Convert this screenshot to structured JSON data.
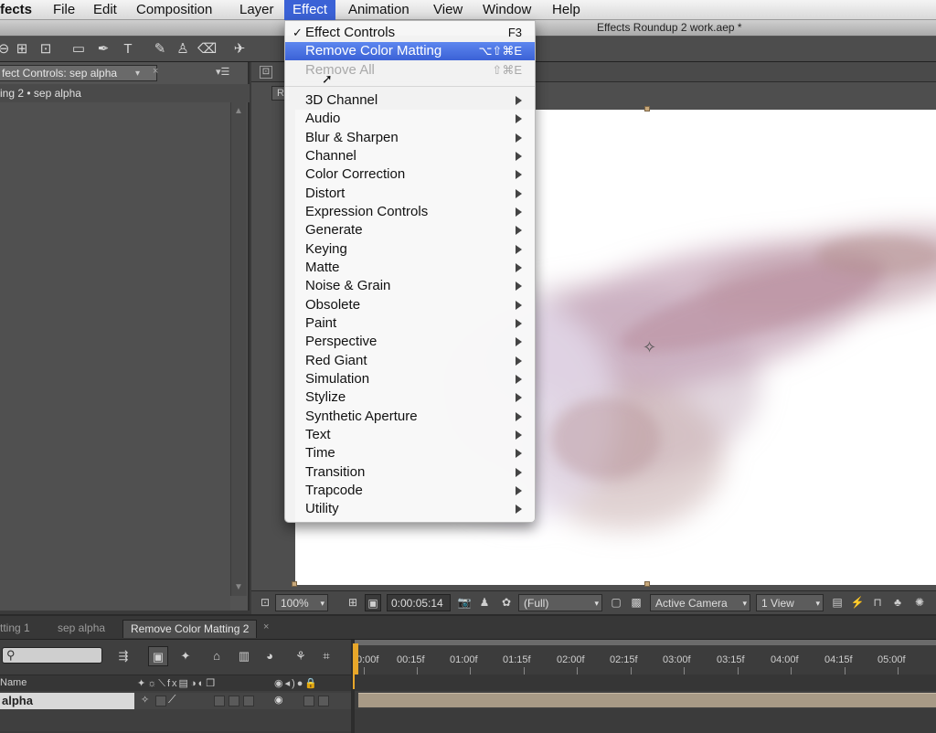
{
  "menubar": {
    "app": "fects",
    "items": [
      "File",
      "Edit",
      "Composition",
      "Layer",
      "Effect",
      "Animation",
      "View",
      "Window",
      "Help"
    ],
    "active": "Effect"
  },
  "window": {
    "title": "Effects Roundup 2 work.aep *"
  },
  "effect_menu": {
    "top_items": [
      {
        "label": "Effect Controls",
        "shortcut": "F3",
        "checked": true
      },
      {
        "label": "Remove Color Matting",
        "shortcut": "⌥⇧⌘E",
        "highlighted": true
      },
      {
        "label": "Remove All",
        "shortcut": "⇧⌘E",
        "disabled": true
      }
    ],
    "categories": [
      "3D Channel",
      "Audio",
      "Blur & Sharpen",
      "Channel",
      "Color Correction",
      "Distort",
      "Expression Controls",
      "Generate",
      "Keying",
      "Matte",
      "Noise & Grain",
      "Obsolete",
      "Paint",
      "Perspective",
      "Red Giant",
      "Simulation",
      "Stylize",
      "Synthetic Aperture",
      "Text",
      "Time",
      "Transition",
      "Trapcode",
      "Utility"
    ]
  },
  "left_panel": {
    "tab_label": "fect Controls: sep alpha",
    "subtitle": "ing 2 • sep alpha"
  },
  "comp_panel": {
    "r_button": "R"
  },
  "viewer_bar": {
    "zoom": "100%",
    "timecode": "0:00:05:14",
    "resolution": "(Full)",
    "camera": "Active Camera",
    "views": "1 View"
  },
  "timeline": {
    "tabs": [
      "tting 1",
      "sep alpha",
      "Remove Color Matting 2"
    ],
    "active_tab": "Remove Color Matting 2",
    "ruler": [
      "0:00f",
      "00:15f",
      "01:00f",
      "01:15f",
      "02:00f",
      "02:15f",
      "03:00f",
      "03:15f",
      "04:00f",
      "04:15f",
      "05:00f"
    ],
    "name_header": "Name",
    "layer_name": "alpha"
  },
  "colors": {
    "menu_highlight": "#3b62d6",
    "panel_bg": "#535353",
    "cti": "#e8a72a"
  }
}
